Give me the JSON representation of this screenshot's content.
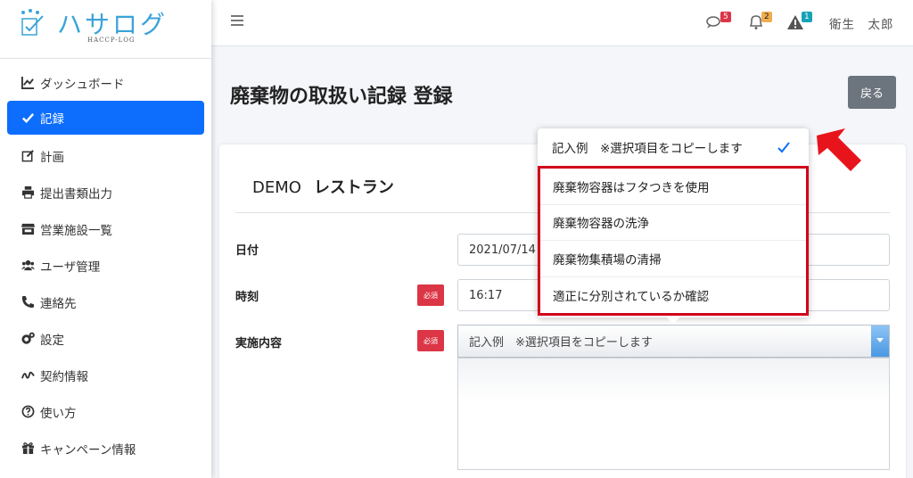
{
  "brand": {
    "name": "ハサログ",
    "sub": "HACCP-LOG"
  },
  "sidebar": {
    "items": [
      {
        "label": "ダッシュボード",
        "icon": "chart-line-icon"
      },
      {
        "label": "記録",
        "icon": "check-icon",
        "active": true
      },
      {
        "label": "計画",
        "icon": "edit-icon"
      },
      {
        "label": "提出書類出力",
        "icon": "print-icon"
      },
      {
        "label": "営業施設一覧",
        "icon": "store-icon"
      },
      {
        "label": "ユーザ管理",
        "icon": "users-icon"
      },
      {
        "label": "連絡先",
        "icon": "phone-icon"
      },
      {
        "label": "設定",
        "icon": "gears-icon"
      },
      {
        "label": "契約情報",
        "icon": "signature-icon"
      },
      {
        "label": "使い方",
        "icon": "question-circle-icon"
      },
      {
        "label": "キャンペーン情報",
        "icon": "gift-icon"
      }
    ]
  },
  "topbar": {
    "messages_count": "5",
    "notifications_count": "2",
    "alerts_count": "1",
    "user_name": "衛生　太郎"
  },
  "page": {
    "title": "廃棄物の取扱い記録 登録",
    "back_label": "戻る",
    "store_prefix": "DEMO",
    "store_name": "レストラン"
  },
  "form": {
    "date_label": "日付",
    "date_value": "2021/07/14",
    "time_label": "時刻",
    "time_value": "16:17",
    "content_label": "実施内容",
    "required_label": "必須",
    "select_value": "記入例　※選択項目をコピーします"
  },
  "dropdown": {
    "header": "記入例　※選択項目をコピーします",
    "items": [
      "廃棄物容器はフタつきを使用",
      "廃棄物容器の洗浄",
      "廃棄物集積場の清掃",
      "適正に分別されているか確認"
    ]
  },
  "colors": {
    "primary": "#0d6efd",
    "brand": "#3aa3d8",
    "required": "#dc3545",
    "highlight": "#d0021b"
  }
}
